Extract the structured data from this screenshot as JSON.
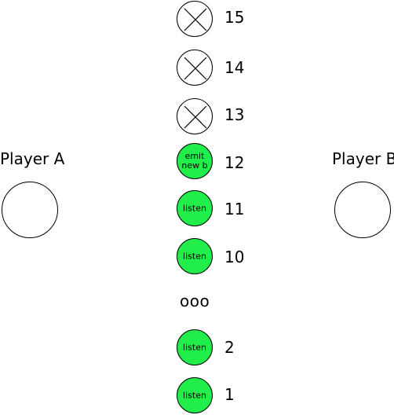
{
  "player_a": {
    "label": "Player A"
  },
  "player_b": {
    "label": "Player B"
  },
  "nodes": [
    {
      "number": "15",
      "state": "crossed",
      "label": ""
    },
    {
      "number": "14",
      "state": "crossed",
      "label": ""
    },
    {
      "number": "13",
      "state": "crossed",
      "label": ""
    },
    {
      "number": "12",
      "state": "active",
      "label": "emit\nnew b"
    },
    {
      "number": "11",
      "state": "active",
      "label": "listen"
    },
    {
      "number": "10",
      "state": "active",
      "label": "listen"
    },
    {
      "number": "2",
      "state": "active",
      "label": "listen"
    },
    {
      "number": "1",
      "state": "active",
      "label": "listen"
    }
  ],
  "ellipsis": "ooo",
  "colors": {
    "active_fill": "#21ee4a",
    "stroke": "#000000",
    "idle_fill": "#ffffff"
  }
}
